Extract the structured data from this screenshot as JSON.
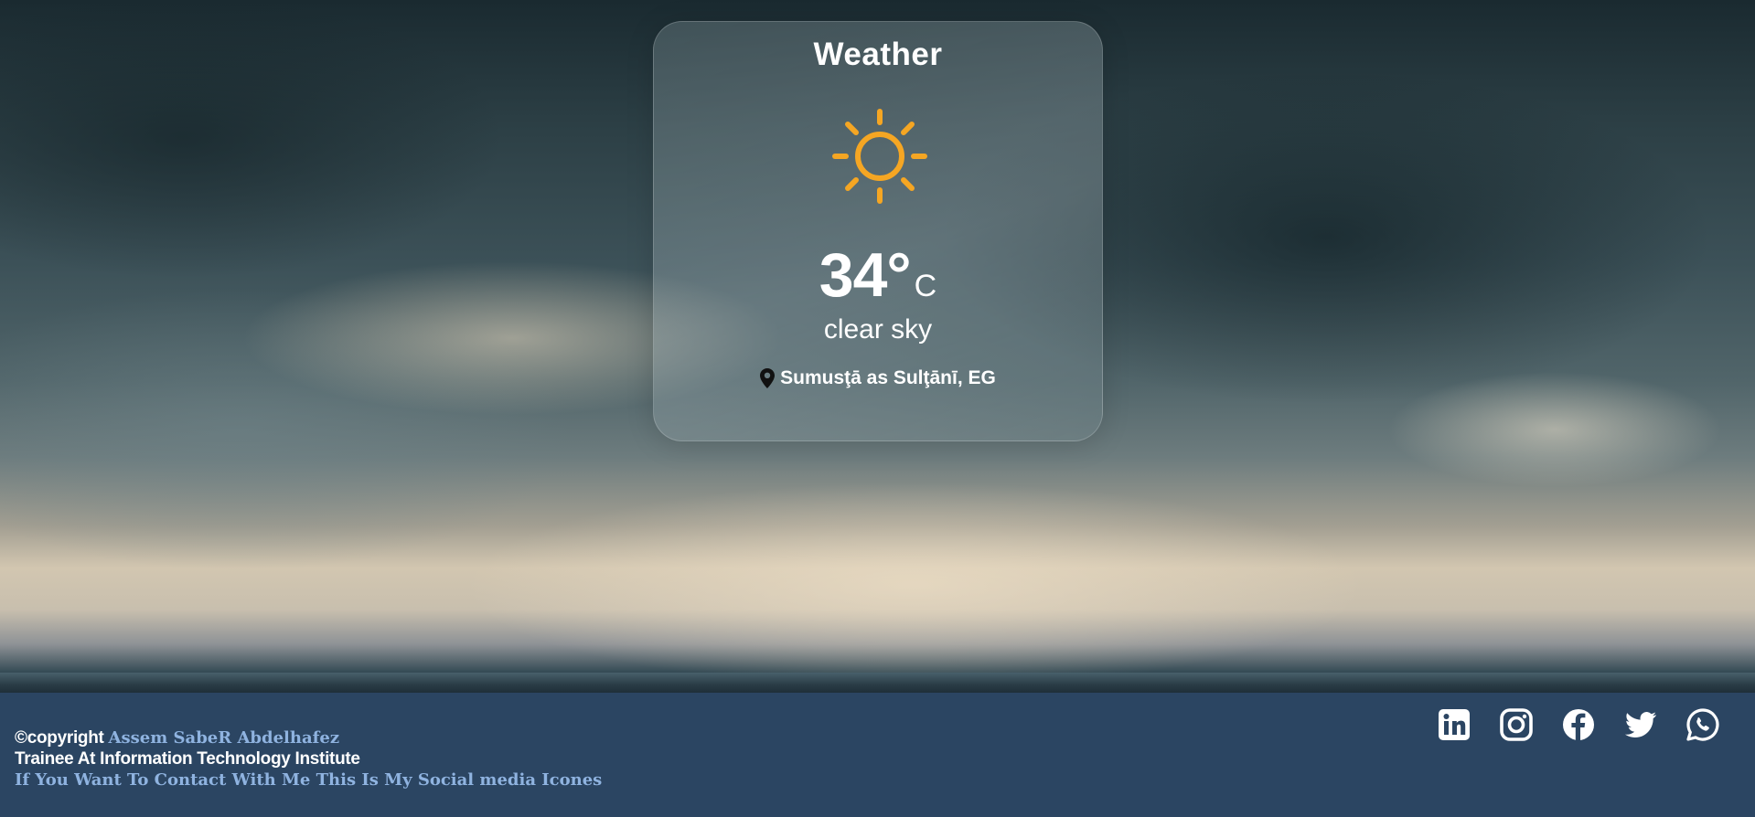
{
  "card": {
    "title": "Weather",
    "icon": "sun-icon",
    "temperature": "34°",
    "unit": "C",
    "description": "clear sky",
    "location": "Sumusţā as Sulţānī, EG"
  },
  "footer": {
    "copyright_prefix": "©copyright ",
    "author": "Assem SabeR Abdelhafez",
    "role": "Trainee At Information Technology Institute",
    "contact_note": "If You Want To Contact With Me This Is My Social media Icones",
    "socials": [
      {
        "name": "linkedin-icon"
      },
      {
        "name": "instagram-icon"
      },
      {
        "name": "facebook-icon"
      },
      {
        "name": "twitter-icon"
      },
      {
        "name": "whatsapp-icon"
      }
    ]
  },
  "colors": {
    "footer_bg": "#2b4562",
    "sun": "#f5a623",
    "link_blue": "#8fb3e0"
  }
}
